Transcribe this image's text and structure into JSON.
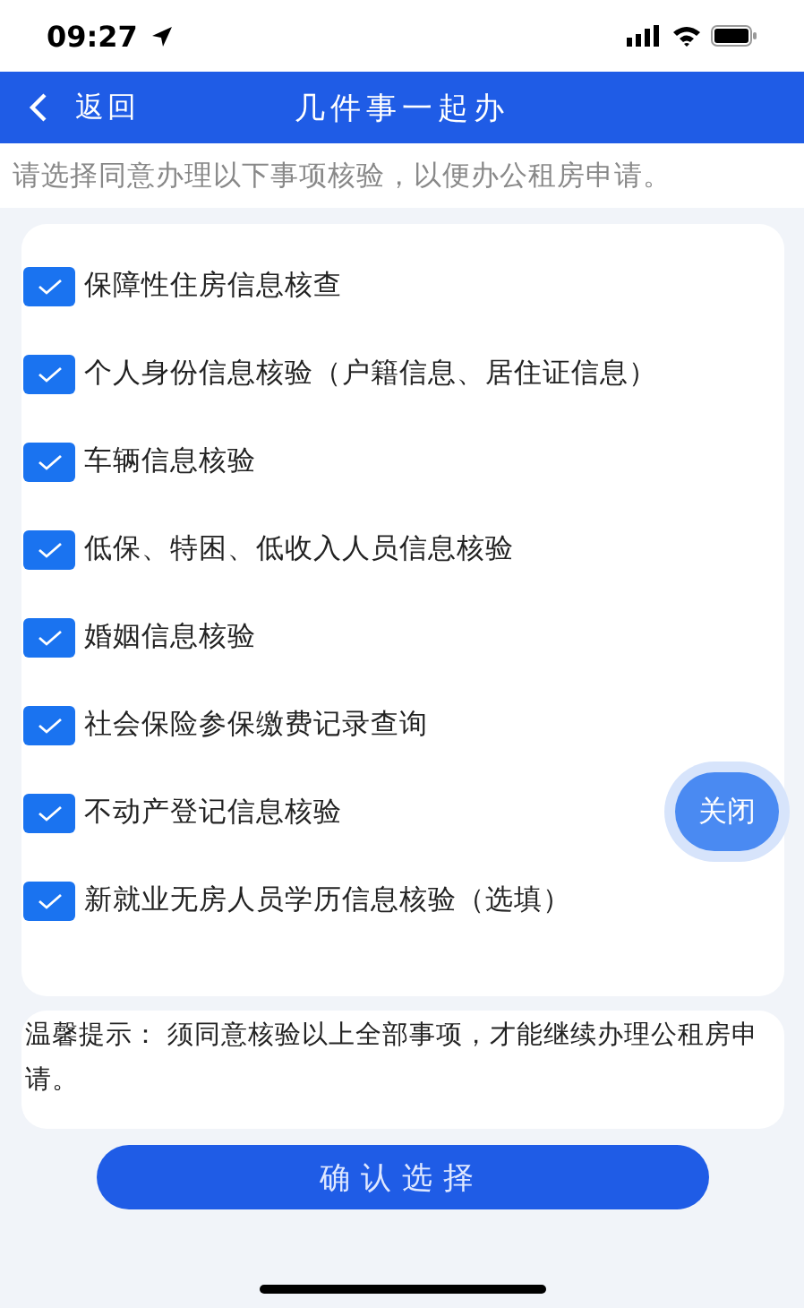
{
  "status_bar": {
    "time": "09:27"
  },
  "nav": {
    "back": "返回",
    "title": "几件事一起办"
  },
  "instruction": "请选择同意办理以下事项核验，以便办公租房申请。",
  "items": [
    {
      "label": "保障性住房信息核查",
      "checked": true
    },
    {
      "label": "个人身份信息核验（户籍信息、居住证信息）",
      "checked": true
    },
    {
      "label": "车辆信息核验",
      "checked": true
    },
    {
      "label": "低保、特困、低收入人员信息核验",
      "checked": true
    },
    {
      "label": "婚姻信息核验",
      "checked": true
    },
    {
      "label": "社会保险参保缴费记录查询",
      "checked": true
    },
    {
      "label": "不动产登记信息核验",
      "checked": true
    },
    {
      "label": "新就业无房人员学历信息核验（选填）",
      "checked": true
    }
  ],
  "tip": "温馨提示：  须同意核验以上全部事项，才能继续办理公租房申请。",
  "confirm_button": "确认选择",
  "float_button": "关闭"
}
